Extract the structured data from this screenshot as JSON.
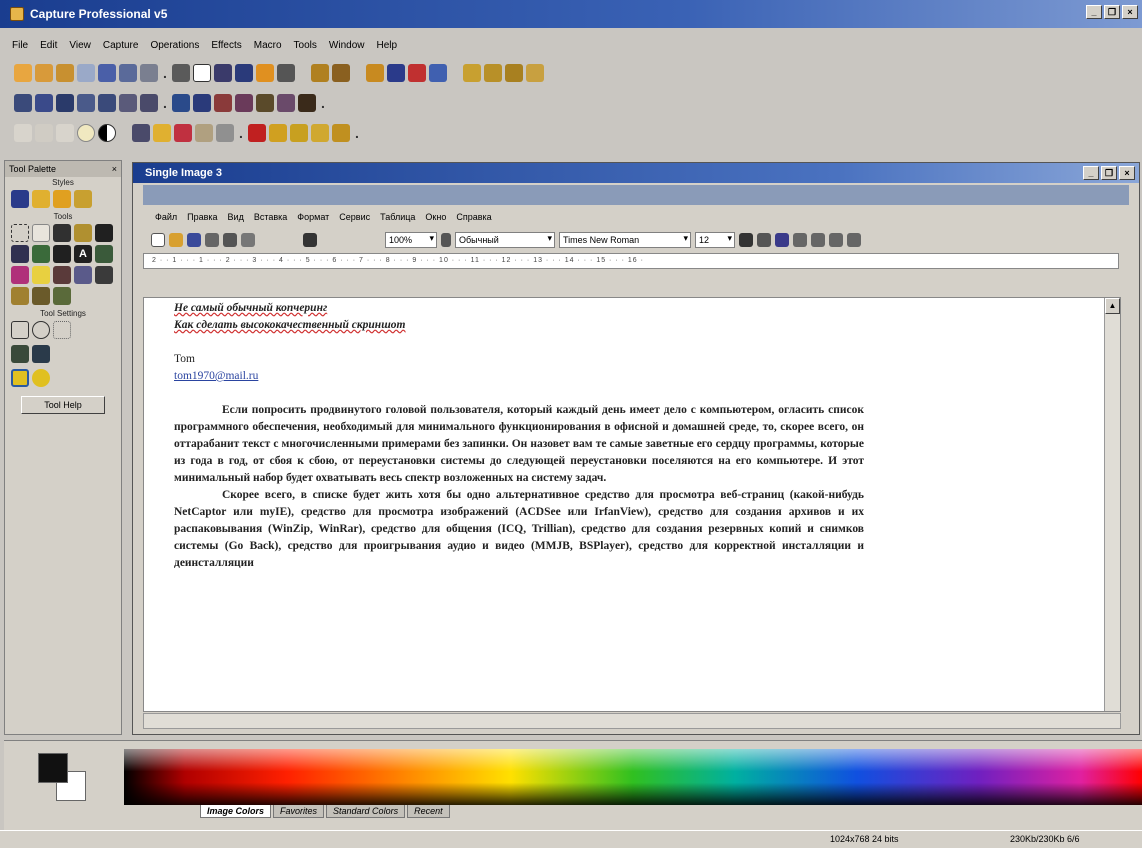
{
  "app": {
    "title": "Capture Professional v5"
  },
  "menu": [
    "File",
    "Edit",
    "View",
    "Capture",
    "Operations",
    "Effects",
    "Macro",
    "Tools",
    "Window",
    "Help"
  ],
  "palette": {
    "title": "Tool Palette",
    "styles_label": "Styles",
    "tools_label": "Tools",
    "tool_settings_label": "Tool Settings",
    "tool_help": "Tool Help"
  },
  "image_window": {
    "title": "Single Image 3",
    "word_menu": [
      "Файл",
      "Правка",
      "Вид",
      "Вставка",
      "Формат",
      "Сервис",
      "Таблица",
      "Окно",
      "Справка"
    ],
    "zoom": "100%",
    "style": "Обычный",
    "font": "Times New Roman",
    "size": "12",
    "ruler": "2 · · 1 · · · 1 · · · 2 · · · 3 · · · 4 · · · 5 · · · 6 · · · 7 · · · 8 · · · 9 · · · 10 · · · 11 · · · 12 · · · 13 · · · 14 · · · 15 · · · 16 ·"
  },
  "document": {
    "line1": "Не самый обычный копчеринг",
    "line2": "Как сделать высококачественный скриншот",
    "author": "Tom",
    "email": "tom1970@mail.ru",
    "para1": "Если попросить продвинутого головой пользователя, который каждый день имеет дело с компьютером, огласить список программного обеспечения, необходимый для минимального функционирования в офисной и домашней среде, то, скорее всего, он оттарабанит текст с многочисленными примерами без запинки. Он назовет вам те самые заветные его сердцу программы, которые из года в год, от сбоя к сбою, от переустановки системы до следующей переустановки поселяются на его компьютере. И этот минимальный набор будет охватывать весь спектр возложенных на систему задач.",
    "para2": "Скорее всего, в списке будет жить хотя бы одно альтернативное средство для просмотра веб-страниц (какой-нибудь NetCaptor или myIE), средство для просмотра изображений (ACDSee или IrfanView), средство для создания архивов и их распаковывания (WinZip, WinRar), средство для общения (ICQ, Trillian), средство для создания резервных копий и снимков системы (Go Back), средство для проигрывания аудио и видео (MMJB, BSPlayer), средство для корректной инсталляции и деинсталляции"
  },
  "colors": {
    "tabs": [
      "Image Colors",
      "Favorites",
      "Standard Colors",
      "Recent"
    ]
  },
  "status": {
    "resolution": "1024x768  24 bits",
    "memory": "230Kb/230Kb   6/6"
  }
}
